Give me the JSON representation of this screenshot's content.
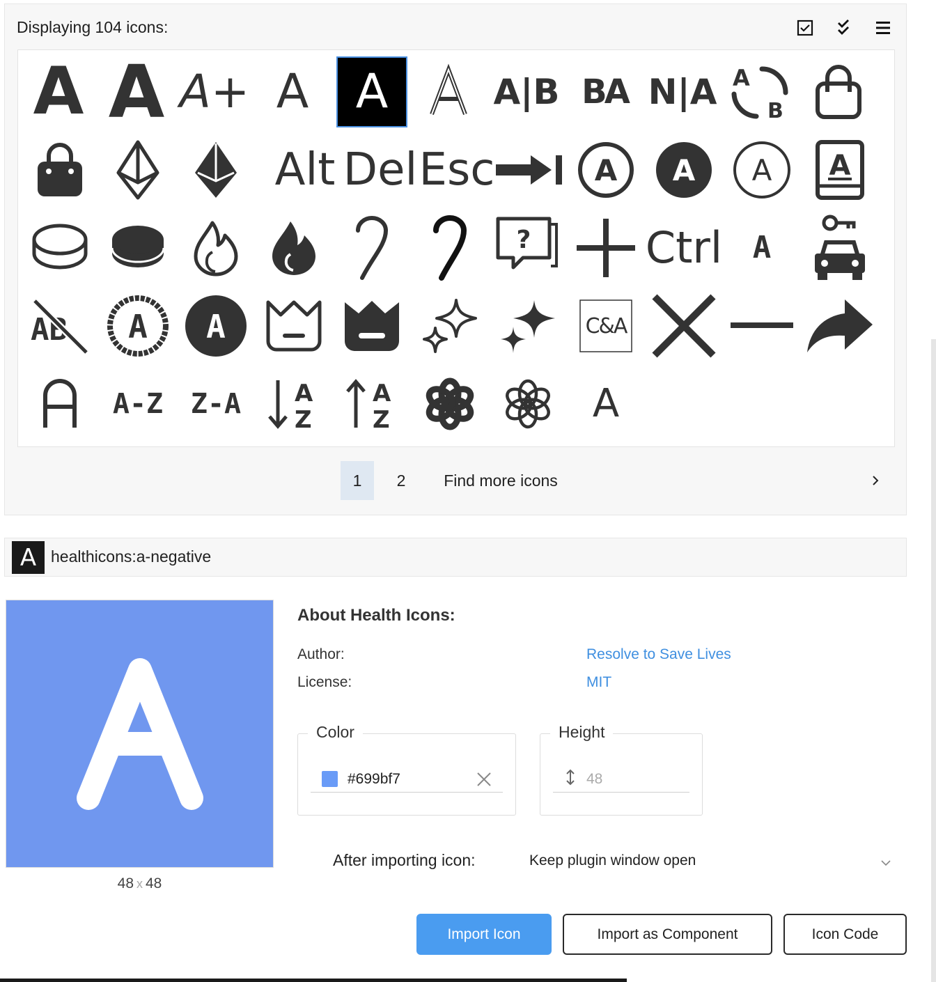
{
  "header": {
    "title": "Displaying 104 icons:",
    "toolbar_icons": [
      "checkbox-checked-icon",
      "double-check-icon",
      "menu-icon"
    ]
  },
  "icons": [
    {
      "name": "bold-a-icon",
      "glyph": "A"
    },
    {
      "name": "extra-bold-a-icon",
      "glyph": "A"
    },
    {
      "name": "a-plus-icon",
      "glyph": "A+"
    },
    {
      "name": "thin-a-icon",
      "glyph": "A"
    },
    {
      "name": "a-negative-icon",
      "glyph": "A"
    },
    {
      "name": "outline-a-icon",
      "glyph": "A"
    },
    {
      "name": "a-b-split-icon",
      "glyph": "A|B"
    },
    {
      "name": "b-a-swap-icon",
      "glyph": "BA"
    },
    {
      "name": "n-a-icon",
      "glyph": "N|A"
    },
    {
      "name": "a-to-b-cycle-icon",
      "glyph": "AB"
    },
    {
      "name": "shopping-bag-outline-icon",
      "glyph": ""
    },
    {
      "name": "shopping-bag-filled-icon",
      "glyph": ""
    },
    {
      "name": "ethereum-outline-icon",
      "glyph": ""
    },
    {
      "name": "ethereum-filled-icon",
      "glyph": ""
    },
    {
      "name": "alt-key-icon",
      "glyph": "Alt"
    },
    {
      "name": "del-key-icon",
      "glyph": "Del"
    },
    {
      "name": "esc-key-icon",
      "glyph": "Esc"
    },
    {
      "name": "arrow-to-line-icon",
      "glyph": ""
    },
    {
      "name": "circle-a-outline-icon",
      "glyph": "A"
    },
    {
      "name": "circle-a-filled-icon",
      "glyph": "A"
    },
    {
      "name": "circle-a-thin-icon",
      "glyph": "A"
    },
    {
      "name": "address-book-icon",
      "glyph": "A"
    },
    {
      "name": "coin-outline-icon",
      "glyph": ""
    },
    {
      "name": "coin-filled-icon",
      "glyph": ""
    },
    {
      "name": "flame-outline-icon",
      "glyph": ""
    },
    {
      "name": "flame-filled-icon",
      "glyph": ""
    },
    {
      "name": "cane-thin-icon",
      "glyph": ""
    },
    {
      "name": "cane-bold-icon",
      "glyph": ""
    },
    {
      "name": "question-chat-icon",
      "glyph": "?"
    },
    {
      "name": "plus-icon",
      "glyph": ""
    },
    {
      "name": "ctrl-key-icon",
      "glyph": "Ctrl"
    },
    {
      "name": "pixel-a-icon",
      "glyph": "A"
    },
    {
      "name": "car-key-icon",
      "glyph": ""
    },
    {
      "name": "ab-off-icon",
      "glyph": "AB"
    },
    {
      "name": "pixel-circle-a-outline-icon",
      "glyph": "A"
    },
    {
      "name": "pixel-circle-a-filled-icon",
      "glyph": "A"
    },
    {
      "name": "crown-outline-icon",
      "glyph": ""
    },
    {
      "name": "crown-filled-icon",
      "glyph": ""
    },
    {
      "name": "sparkles-outline-icon",
      "glyph": ""
    },
    {
      "name": "sparkles-filled-icon",
      "glyph": ""
    },
    {
      "name": "match-case-icon",
      "glyph": "C&A"
    },
    {
      "name": "close-x-icon",
      "glyph": ""
    },
    {
      "name": "minus-icon",
      "glyph": ""
    },
    {
      "name": "share-arrow-icon",
      "glyph": ""
    },
    {
      "name": "arch-a-icon",
      "glyph": "A"
    },
    {
      "name": "a-z-icon",
      "glyph": "A-Z"
    },
    {
      "name": "z-a-icon",
      "glyph": "Z-A"
    },
    {
      "name": "sort-a-z-down-icon",
      "glyph": "AZ"
    },
    {
      "name": "sort-a-z-up-icon",
      "glyph": "AZ"
    },
    {
      "name": "openai-filled-icon",
      "glyph": ""
    },
    {
      "name": "openai-outline-icon",
      "glyph": ""
    },
    {
      "name": "letter-a-icon",
      "glyph": "A"
    }
  ],
  "pagination": {
    "page1": "1",
    "page2": "2",
    "more": "Find more icons",
    "next_icon": "chevron-right-icon"
  },
  "selected": {
    "name": "healthicons:a-negative",
    "glyph": "A"
  },
  "preview": {
    "glyph": "A",
    "width": "48",
    "sep": "x",
    "height": "48",
    "bg_color": "#7097ef"
  },
  "about": {
    "title": "About Health Icons:",
    "author_label": "Author:",
    "author_value": "Resolve to Save Lives",
    "license_label": "License:",
    "license_value": "MIT"
  },
  "color_field": {
    "legend": "Color",
    "value": "#699bf7",
    "swatch": "#699bf7",
    "clear_icon": "close-icon"
  },
  "height_field": {
    "legend": "Height",
    "placeholder": "48",
    "icon": "vertical-resize-icon"
  },
  "after_import": {
    "label": "After importing icon:",
    "value": "Keep plugin window open",
    "chevron": "chevron-down-icon"
  },
  "buttons": {
    "import": "Import Icon",
    "import_component": "Import as Component",
    "code": "Icon Code"
  }
}
